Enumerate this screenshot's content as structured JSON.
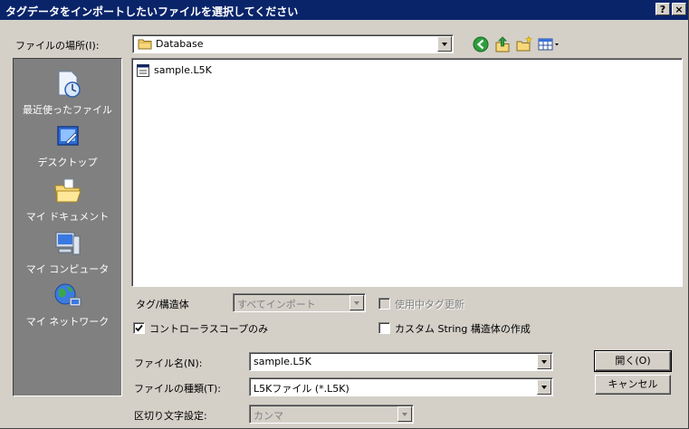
{
  "window": {
    "title": "タグデータをインポートしたいファイルを選択してください",
    "help_button": "?",
    "close_button": "×"
  },
  "lookin": {
    "label": "ファイルの場所(I):",
    "value": "Database",
    "folder_icon": "folder-icon"
  },
  "toolbar": {
    "back_icon": "back-arrow-icon",
    "up_icon": "up-folder-icon",
    "newfolder_icon": "new-folder-icon",
    "views_icon": "views-menu-icon"
  },
  "places": [
    {
      "label": "最近使ったファイル",
      "icon": "recent-files-icon"
    },
    {
      "label": "デスクトップ",
      "icon": "desktop-icon"
    },
    {
      "label": "マイ ドキュメント",
      "icon": "my-documents-icon"
    },
    {
      "label": "マイ コンピュータ",
      "icon": "my-computer-icon"
    },
    {
      "label": "マイ ネットワーク",
      "icon": "my-network-icon"
    }
  ],
  "files": [
    {
      "name": "sample.L5K",
      "icon": "l5k-file-icon"
    }
  ],
  "options": {
    "tag_struct_label": "タグ/構造体",
    "tag_struct_value": "すべてインポート",
    "update_used_tags_label": "使用中タグ更新",
    "update_used_tags_checked": false,
    "controller_scope_label": "コントローラスコープのみ",
    "controller_scope_checked": true,
    "custom_string_label": "カスタム String 構造体の作成",
    "custom_string_checked": false
  },
  "filename": {
    "label": "ファイル名(N):",
    "value": "sample.L5K"
  },
  "filetype": {
    "label": "ファイルの種類(T):",
    "value": "L5Kファイル (*.L5K)"
  },
  "delimiter": {
    "label": "区切り文字設定:",
    "value": "カンマ"
  },
  "buttons": {
    "open": "開く(O)",
    "cancel": "キャンセル"
  },
  "colors": {
    "titlebar": "#0a246a",
    "face": "#d4d0c8",
    "places_bar": "#808080"
  }
}
